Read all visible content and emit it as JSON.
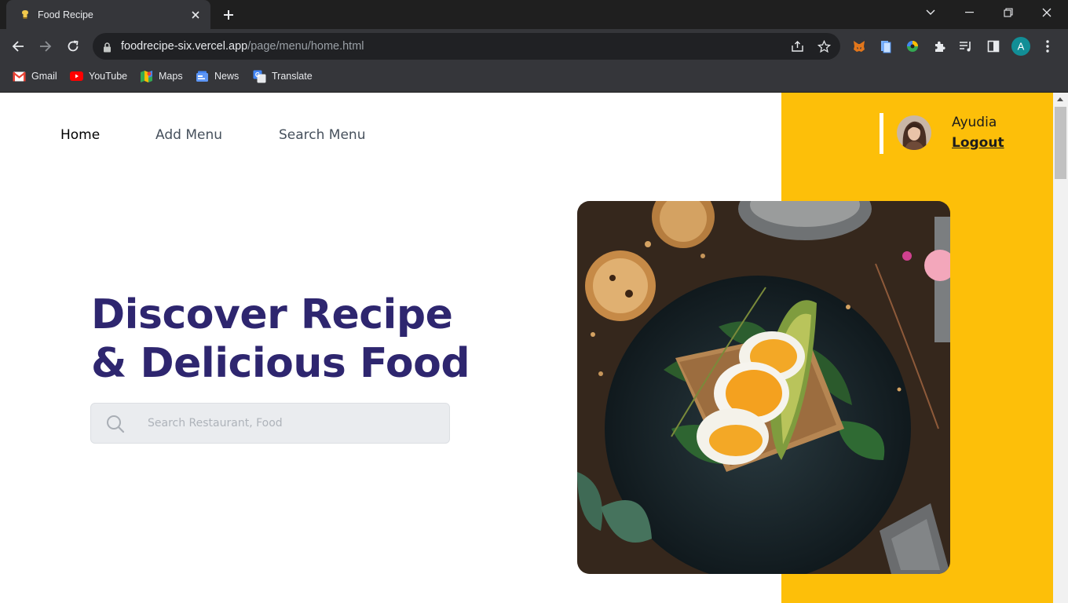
{
  "browser": {
    "tab_title": "Food Recipe",
    "url_host": "foodrecipe-six.vercel.app",
    "url_path": "/page/menu/home.html",
    "profile_initial": "A",
    "bookmarks": [
      {
        "label": "Gmail",
        "icon": "gmail-icon"
      },
      {
        "label": "YouTube",
        "icon": "youtube-icon"
      },
      {
        "label": "Maps",
        "icon": "maps-icon"
      },
      {
        "label": "News",
        "icon": "news-icon"
      },
      {
        "label": "Translate",
        "icon": "translate-icon"
      }
    ]
  },
  "nav": {
    "home": "Home",
    "add_menu": "Add Menu",
    "search_menu": "Search Menu"
  },
  "user": {
    "name": "Ayudia",
    "logout": "Logout"
  },
  "hero": {
    "line1": "Discover Recipe",
    "line2": "& Delicious Food"
  },
  "search": {
    "placeholder": "Search Restaurant, Food"
  },
  "colors": {
    "accent_yellow": "#fdbf09",
    "heading_purple": "#2e266f"
  }
}
